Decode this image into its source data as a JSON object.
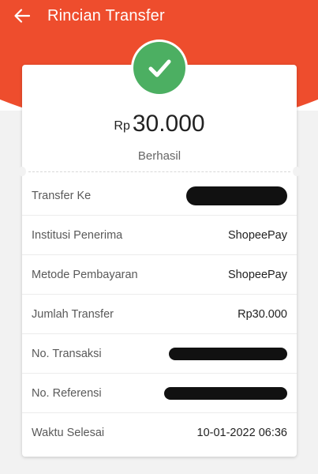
{
  "header": {
    "title": "Rincian Transfer"
  },
  "summary": {
    "currency": "Rp",
    "amount": "30.000",
    "status": "Berhasil"
  },
  "colors": {
    "brand": "#ee4d2d",
    "success": "#4caf62"
  },
  "details": [
    {
      "label": "Transfer Ke",
      "value": ""
    },
    {
      "label": "Institusi Penerima",
      "value": "ShopeePay"
    },
    {
      "label": "Metode Pembayaran",
      "value": "ShopeePay"
    },
    {
      "label": "Jumlah Transfer",
      "value": "Rp30.000"
    },
    {
      "label": "No. Transaksi",
      "value": ""
    },
    {
      "label": "No. Referensi",
      "value": ""
    },
    {
      "label": "Waktu Selesai",
      "value": "10-01-2022 06:36"
    }
  ]
}
